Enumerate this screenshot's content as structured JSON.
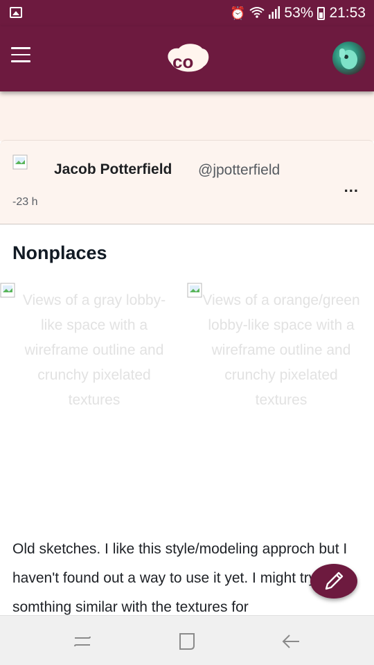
{
  "statusbar": {
    "battery_percent": "53%",
    "clock": "21:53",
    "icons": [
      "gallery-icon",
      "alarm-icon",
      "wifi-icon",
      "signal-icon",
      "battery-icon"
    ]
  },
  "appbar": {
    "logo_text": "co",
    "icons": [
      "hamburger-menu-icon",
      "avatar"
    ]
  },
  "post": {
    "display_name": "Jacob Potterfield",
    "handle": "@jpotterfield",
    "time": "-23 h",
    "more_label": "...",
    "title": "Nonplaces",
    "images": [
      {
        "alt": "Views of a gray lobby-like space with a wireframe outline and crunchy pixelated textures"
      },
      {
        "alt": "Views of a orange/green lobby-like space with a wireframe outline and crunchy pixelated textures"
      }
    ],
    "body": "Old sketches. I like this style/modeling approch but I haven't found out a way to use it yet. I might try somthing similar with the textures for"
  },
  "fab": {
    "icon": "pencil-icon"
  },
  "navbar": {
    "icons": [
      "recents-icon",
      "home-icon",
      "back-icon"
    ]
  },
  "colors": {
    "brand": "#6d1a3f",
    "card_bg": "#fdf4ef",
    "navbar_bg": "#f0f0f0"
  }
}
